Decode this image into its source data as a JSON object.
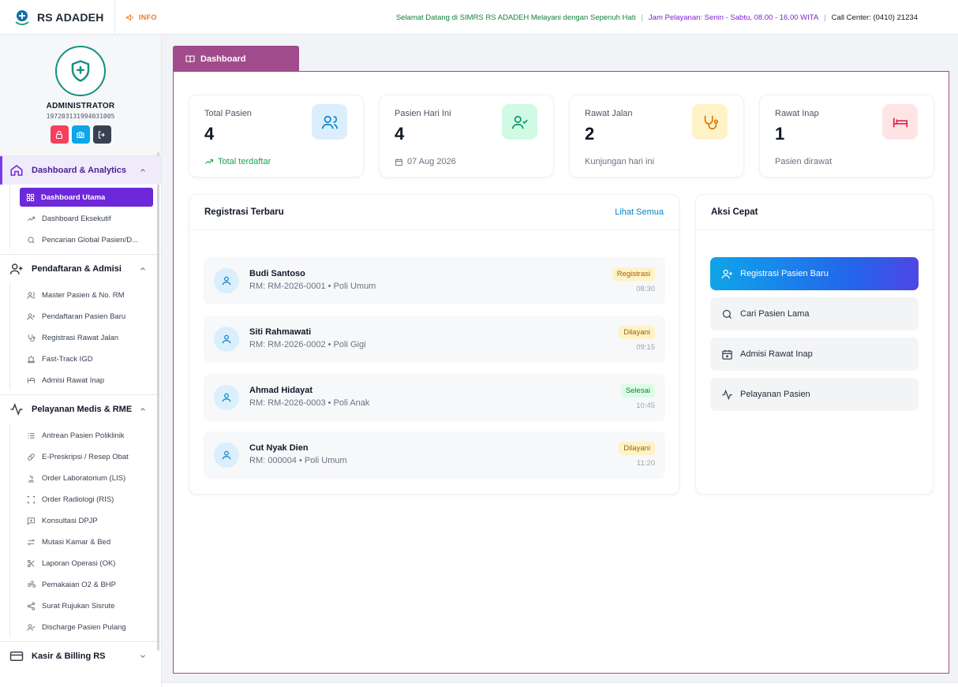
{
  "header": {
    "app_name": "RS ADADEH",
    "info_label": "INFO",
    "welcome": "Selamat Datang di SIMRS RS ADADEH Melayani dengan Sepenuh Hati",
    "separator": "|",
    "hours": "Jam Pelayanan: Senin - Sabtu, 08.00 - 16.00 WITA",
    "call_center": "Call Center: (0410) 21234"
  },
  "profile": {
    "name": "ADMINISTRATOR",
    "id": "197203131994031005"
  },
  "sidebar": {
    "groups": [
      {
        "label": "Dashboard & Analytics",
        "icon": "home-icon",
        "items": [
          {
            "label": "Dashboard Utama",
            "icon": "grid-icon"
          },
          {
            "label": "Dashboard Eksekutif",
            "icon": "trending-icon"
          },
          {
            "label": "Pencarian Global Pasien/D...",
            "icon": "search-icon"
          }
        ]
      },
      {
        "label": "Pendaftaran & Admisi",
        "icon": "user-plus-icon",
        "items": [
          {
            "label": "Master Pasien & No. RM",
            "icon": "users-icon"
          },
          {
            "label": "Pendaftaran Pasien Baru",
            "icon": "user-plus-icon"
          },
          {
            "label": "Registrasi Rawat Jalan",
            "icon": "stethoscope-icon"
          },
          {
            "label": "Fast-Track IGD",
            "icon": "siren-icon"
          },
          {
            "label": "Admisi Rawat Inap",
            "icon": "bed-icon"
          }
        ]
      },
      {
        "label": "Pelayanan Medis & RME",
        "icon": "activity-icon",
        "items": [
          {
            "label": "Antrean Pasien Poliklinik",
            "icon": "list-icon"
          },
          {
            "label": "E-Preskripsi / Resep Obat",
            "icon": "pill-icon"
          },
          {
            "label": "Order Laboratorium (LIS)",
            "icon": "microscope-icon"
          },
          {
            "label": "Order Radiologi (RIS)",
            "icon": "scan-icon"
          },
          {
            "label": "Konsultasi DPJP",
            "icon": "message-plus-icon"
          },
          {
            "label": "Mutasi Kamar & Bed",
            "icon": "transfer-icon"
          },
          {
            "label": "Laporan Operasi (OK)",
            "icon": "scissors-icon"
          },
          {
            "label": "Pemakaian O2 & BHP",
            "icon": "wind-icon"
          },
          {
            "label": "Surat Rujukan Sisrute",
            "icon": "share-icon"
          },
          {
            "label": "Discharge Pasien Pulang",
            "icon": "user-check-icon"
          }
        ]
      },
      {
        "label": "Kasir & Billing RS",
        "icon": "credit-card-icon",
        "items": []
      }
    ]
  },
  "tab": {
    "label": "Dashboard"
  },
  "stats": [
    {
      "label": "Total Pasien",
      "value": "4",
      "sub": "Total terdaftar",
      "icon": "users-icon",
      "color": "#0ea5e9"
    },
    {
      "label": "Pasien Hari Ini",
      "value": "4",
      "sub": "07 Aug 2026",
      "icon": "user-check-icon",
      "color": "#10b981"
    },
    {
      "label": "Rawat Jalan",
      "value": "2",
      "sub": "Kunjungan hari ini",
      "icon": "stethoscope-icon",
      "color": "#d97706"
    },
    {
      "label": "Rawat Inap",
      "value": "1",
      "sub": "Pasien dirawat",
      "icon": "bed-icon",
      "color": "#e11d48"
    }
  ],
  "registrations": {
    "title": "Registrasi Terbaru",
    "link": "Lihat Semua",
    "rows": [
      {
        "name": "Budi Santoso",
        "meta": "RM: RM-2026-0001 • Poli Umum",
        "status": "Registrasi",
        "time": "08:30"
      },
      {
        "name": "Siti Rahmawati",
        "meta": "RM: RM-2026-0002 • Poli Gigi",
        "status": "Dilayani",
        "time": "09:15"
      },
      {
        "name": "Ahmad Hidayat",
        "meta": "RM: RM-2026-0003 • Poli Anak",
        "status": "Selesai",
        "time": "10:45"
      },
      {
        "name": "Cut Nyak Dien",
        "meta": "RM: 000004 • Poli Umum",
        "status": "Dilayani",
        "time": "11:20"
      }
    ]
  },
  "quick_actions": {
    "title": "Aksi Cepat",
    "items": [
      {
        "label": "Registrasi Pasien Baru",
        "icon": "user-plus-icon"
      },
      {
        "label": "Cari Pasien Lama",
        "icon": "search-icon"
      },
      {
        "label": "Admisi Rawat Inap",
        "icon": "calendar-plus-icon"
      },
      {
        "label": "Pelayanan Pasien",
        "icon": "activity-icon"
      }
    ]
  },
  "colors": {
    "accent": "#6d28d9",
    "tab": "#a04b8b",
    "link": "#0284c7"
  }
}
